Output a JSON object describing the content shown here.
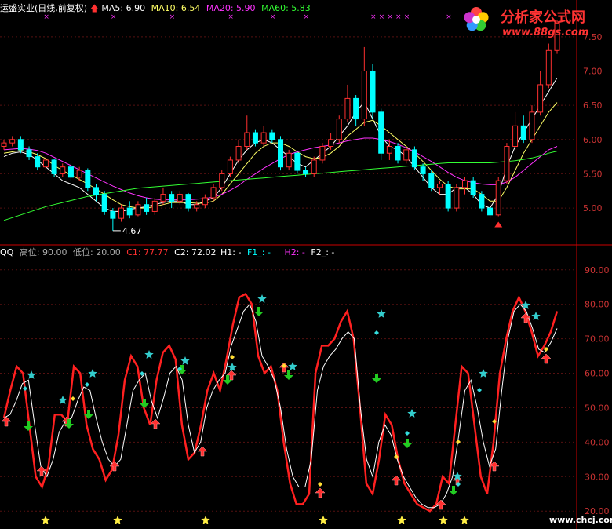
{
  "top_header": {
    "title": "运盛实业(日线,前复权)",
    "ma5_label": "MA5: 6.90",
    "ma10_label": "MA10: 6.54",
    "ma20_label": "MA20: 5.90",
    "ma60_label": "MA60: 5.83"
  },
  "bottom_header": {
    "name": "QQ",
    "high_label": "高位: 90.00",
    "low_label": "低位: 20.00",
    "c1_label": "C1: 77.77",
    "c2_label": "C2: 72.02",
    "h1_label": "H1: -",
    "f1_label": "F1_: -",
    "h2_label": "H2: -",
    "f2_label": "F2_: -"
  },
  "watermark": {
    "text1": "分析家公式网",
    "text2": "www.88gs.com",
    "text3": "www.chcj.com"
  },
  "colors": {
    "bg": "#000000",
    "up": "#ff3030",
    "down": "#00ffff",
    "ma5": "#ffffff",
    "ma10": "#ffff66",
    "ma20": "#ff33ff",
    "ma60": "#33ff33",
    "axis": "#cc0000",
    "c1": "#ff2020",
    "c2": "#ffffff"
  },
  "chart_data": [
    {
      "type": "candlestick",
      "title": "运盛实业(日线,前复权)",
      "ylim": [
        4.6,
        7.75
      ],
      "yticks": [
        "7.50",
        "7.00",
        "6.50",
        "6.00",
        "5.50",
        "5.00"
      ],
      "annotation": "4.67",
      "series": [
        {
          "name": "MA5",
          "values": [
            5.75,
            5.8,
            5.82,
            5.78,
            5.7,
            5.6,
            5.5,
            5.4,
            5.35,
            5.3,
            5.2,
            5.1,
            5.0,
            4.95,
            4.95,
            4.98,
            5.0,
            5.02,
            5.05,
            5.08,
            5.1,
            5.1,
            5.05,
            5.05,
            5.1,
            5.15,
            5.3,
            5.5,
            5.7,
            5.85,
            5.95,
            6.0,
            5.95,
            5.85,
            5.75,
            5.65,
            5.6,
            5.7,
            5.8,
            5.9,
            6.05,
            6.2,
            6.4,
            6.55,
            6.3,
            6.05,
            5.9,
            5.85,
            5.75,
            5.6,
            5.45,
            5.3,
            5.2,
            5.2,
            5.3,
            5.3,
            5.2,
            5.05,
            5.0,
            5.2,
            5.6,
            5.9,
            6.1,
            6.3,
            6.5,
            6.7,
            6.9
          ]
        },
        {
          "name": "MA10",
          "values": [
            5.8,
            5.82,
            5.84,
            5.82,
            5.78,
            5.72,
            5.62,
            5.55,
            5.48,
            5.42,
            5.35,
            5.28,
            5.2,
            5.12,
            5.05,
            5.02,
            5.0,
            5.0,
            5.02,
            5.05,
            5.08,
            5.08,
            5.08,
            5.07,
            5.07,
            5.1,
            5.2,
            5.35,
            5.5,
            5.65,
            5.8,
            5.9,
            5.95,
            5.95,
            5.9,
            5.82,
            5.75,
            5.72,
            5.74,
            5.8,
            5.9,
            6.05,
            6.15,
            6.25,
            6.28,
            6.2,
            6.1,
            6.0,
            5.9,
            5.8,
            5.68,
            5.55,
            5.42,
            5.32,
            5.28,
            5.28,
            5.28,
            5.2,
            5.1,
            5.1,
            5.3,
            5.55,
            5.8,
            6.0,
            6.2,
            6.4,
            6.54
          ]
        },
        {
          "name": "MA20",
          "values": [
            5.85,
            5.86,
            5.87,
            5.86,
            5.84,
            5.8,
            5.74,
            5.68,
            5.62,
            5.56,
            5.5,
            5.44,
            5.38,
            5.32,
            5.27,
            5.22,
            5.18,
            5.15,
            5.13,
            5.12,
            5.12,
            5.12,
            5.12,
            5.13,
            5.14,
            5.16,
            5.2,
            5.26,
            5.33,
            5.42,
            5.5,
            5.58,
            5.65,
            5.72,
            5.78,
            5.82,
            5.85,
            5.88,
            5.9,
            5.92,
            5.95,
            5.98,
            6.0,
            6.02,
            6.02,
            6.0,
            5.97,
            5.93,
            5.88,
            5.82,
            5.75,
            5.68,
            5.6,
            5.52,
            5.45,
            5.4,
            5.37,
            5.35,
            5.34,
            5.34,
            5.38,
            5.45,
            5.55,
            5.65,
            5.75,
            5.85,
            5.9
          ]
        },
        {
          "name": "MA60",
          "values": [
            4.82,
            4.86,
            4.9,
            4.94,
            4.98,
            5.02,
            5.05,
            5.08,
            5.11,
            5.14,
            5.17,
            5.19,
            5.21,
            5.23,
            5.25,
            5.27,
            5.29,
            5.3,
            5.31,
            5.32,
            5.33,
            5.34,
            5.35,
            5.36,
            5.37,
            5.38,
            5.39,
            5.4,
            5.41,
            5.42,
            5.43,
            5.44,
            5.45,
            5.46,
            5.47,
            5.48,
            5.49,
            5.5,
            5.51,
            5.52,
            5.53,
            5.54,
            5.55,
            5.56,
            5.57,
            5.58,
            5.59,
            5.6,
            5.61,
            5.62,
            5.63,
            5.64,
            5.65,
            5.66,
            5.66,
            5.66,
            5.66,
            5.66,
            5.66,
            5.67,
            5.68,
            5.69,
            5.71,
            5.73,
            5.76,
            5.8,
            5.83
          ]
        }
      ],
      "candles": [
        [
          5.9,
          5.95,
          6.0,
          5.85
        ],
        [
          5.95,
          6.0,
          6.05,
          5.9
        ],
        [
          6.0,
          5.85,
          6.05,
          5.8
        ],
        [
          5.85,
          5.75,
          5.9,
          5.7
        ],
        [
          5.75,
          5.6,
          5.8,
          5.55
        ],
        [
          5.6,
          5.7,
          5.75,
          5.55
        ],
        [
          5.7,
          5.5,
          5.72,
          5.45
        ],
        [
          5.5,
          5.6,
          5.65,
          5.45
        ],
        [
          5.6,
          5.45,
          5.65,
          5.4
        ],
        [
          5.45,
          5.55,
          5.6,
          5.4
        ],
        [
          5.55,
          5.3,
          5.58,
          5.25
        ],
        [
          5.3,
          5.2,
          5.35,
          5.1
        ],
        [
          5.2,
          4.95,
          5.25,
          4.9
        ],
        [
          4.95,
          4.85,
          5.0,
          4.67
        ],
        [
          4.85,
          5.0,
          5.05,
          4.8
        ],
        [
          5.0,
          4.9,
          5.1,
          4.85
        ],
        [
          4.9,
          5.05,
          5.1,
          4.88
        ],
        [
          5.05,
          4.95,
          5.15,
          4.9
        ],
        [
          4.95,
          5.1,
          5.15,
          4.9
        ],
        [
          5.1,
          5.2,
          5.3,
          5.05
        ],
        [
          5.2,
          5.1,
          5.25,
          5.0
        ],
        [
          5.1,
          5.2,
          5.25,
          5.05
        ],
        [
          5.2,
          5.0,
          5.22,
          4.95
        ],
        [
          5.0,
          5.05,
          5.1,
          4.95
        ],
        [
          5.05,
          5.15,
          5.2,
          5.0
        ],
        [
          5.15,
          5.3,
          5.35,
          5.1
        ],
        [
          5.3,
          5.5,
          5.55,
          5.25
        ],
        [
          5.5,
          5.7,
          5.75,
          5.45
        ],
        [
          5.7,
          5.9,
          6.0,
          5.65
        ],
        [
          5.9,
          6.1,
          6.35,
          5.85
        ],
        [
          6.1,
          5.95,
          6.15,
          5.9
        ],
        [
          5.95,
          6.1,
          6.2,
          5.9
        ],
        [
          6.1,
          6.0,
          6.15,
          5.95
        ],
        [
          6.0,
          5.6,
          6.05,
          5.55
        ],
        [
          5.6,
          5.8,
          5.85,
          5.55
        ],
        [
          5.8,
          5.55,
          5.82,
          5.5
        ],
        [
          5.55,
          5.5,
          5.6,
          5.45
        ],
        [
          5.5,
          5.7,
          5.75,
          5.45
        ],
        [
          5.7,
          5.9,
          5.95,
          5.65
        ],
        [
          5.9,
          6.0,
          6.1,
          5.85
        ],
        [
          6.0,
          6.3,
          6.35,
          5.95
        ],
        [
          6.3,
          6.6,
          6.8,
          6.25
        ],
        [
          6.6,
          6.3,
          6.65,
          6.2
        ],
        [
          6.3,
          7.0,
          7.35,
          6.2
        ],
        [
          7.0,
          6.4,
          7.1,
          6.3
        ],
        [
          6.4,
          5.8,
          6.45,
          5.7
        ],
        [
          5.8,
          5.9,
          6.0,
          5.7
        ],
        [
          5.9,
          5.7,
          5.95,
          5.65
        ],
        [
          5.7,
          5.85,
          5.9,
          5.65
        ],
        [
          5.85,
          5.6,
          5.9,
          5.55
        ],
        [
          5.6,
          5.5,
          5.65,
          5.4
        ],
        [
          5.5,
          5.3,
          5.55,
          5.25
        ],
        [
          5.3,
          5.35,
          5.4,
          5.2
        ],
        [
          5.35,
          5.0,
          5.4,
          4.95
        ],
        [
          5.0,
          5.3,
          5.35,
          4.95
        ],
        [
          5.3,
          5.4,
          5.45,
          5.2
        ],
        [
          5.4,
          5.2,
          5.45,
          5.15
        ],
        [
          5.2,
          5.0,
          5.25,
          4.95
        ],
        [
          5.0,
          4.9,
          5.05,
          4.85
        ],
        [
          4.9,
          5.4,
          5.45,
          4.88
        ],
        [
          5.4,
          5.9,
          5.95,
          5.35
        ],
        [
          5.9,
          6.2,
          6.4,
          5.85
        ],
        [
          6.2,
          6.0,
          6.35,
          5.95
        ],
        [
          6.0,
          6.4,
          6.5,
          5.95
        ],
        [
          6.4,
          6.8,
          7.0,
          6.35
        ],
        [
          6.8,
          7.3,
          7.4,
          6.75
        ],
        [
          7.3,
          7.7,
          7.75,
          7.25
        ]
      ]
    },
    {
      "type": "line",
      "title": "QQ",
      "ylim": [
        18,
        92
      ],
      "yticks": [
        "90.00",
        "80.00",
        "70.00",
        "60.00",
        "50.00",
        "40.00",
        "30.00",
        "20.00"
      ],
      "series": [
        {
          "name": "C1",
          "values": [
            47,
            55,
            62,
            60,
            45,
            30,
            27,
            33,
            48,
            48,
            46,
            62,
            60,
            45,
            38,
            35,
            29,
            32,
            42,
            58,
            65,
            62,
            50,
            45,
            58,
            66,
            68,
            64,
            45,
            35,
            37,
            45,
            55,
            60,
            55,
            64,
            74,
            82,
            83,
            80,
            65,
            60,
            62,
            55,
            40,
            28,
            22,
            22,
            25,
            60,
            68,
            68,
            70,
            75,
            78,
            70,
            50,
            28,
            25,
            35,
            48,
            45,
            35,
            28,
            25,
            22,
            21,
            20,
            22,
            30,
            28,
            45,
            62,
            60,
            45,
            30,
            25,
            40,
            60,
            70,
            78,
            82,
            78,
            72,
            65,
            68,
            72,
            78
          ]
        },
        {
          "name": "C2",
          "values": [
            47,
            48,
            52,
            57,
            58,
            45,
            33,
            30,
            35,
            43,
            46,
            47,
            52,
            56,
            55,
            47,
            40,
            35,
            33,
            35,
            45,
            55,
            58,
            60,
            52,
            47,
            53,
            60,
            62,
            58,
            45,
            37,
            40,
            50,
            55,
            58,
            60,
            68,
            73,
            78,
            80,
            75,
            65,
            62,
            58,
            50,
            38,
            30,
            27,
            27,
            35,
            55,
            62,
            65,
            67,
            70,
            72,
            70,
            50,
            35,
            30,
            40,
            45,
            42,
            35,
            30,
            27,
            24,
            22,
            21,
            21,
            22,
            25,
            30,
            42,
            55,
            58,
            50,
            40,
            33,
            38,
            55,
            70,
            78,
            80,
            78,
            73,
            67,
            66,
            69,
            73
          ]
        }
      ],
      "markers": {
        "red_up_arrows": 15,
        "green_down_arrows": 11,
        "cyan_stars": 14,
        "yellow_stars": 7
      }
    }
  ]
}
